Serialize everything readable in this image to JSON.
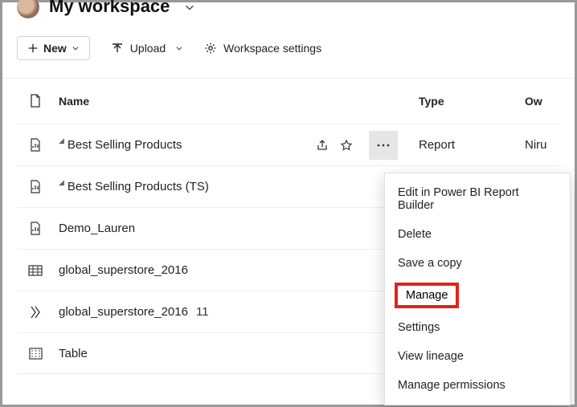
{
  "workspace": {
    "title": "My workspace"
  },
  "toolbar": {
    "new_label": "New",
    "upload_label": "Upload",
    "settings_label": "Workspace settings"
  },
  "columns": {
    "name": "Name",
    "type": "Type",
    "owner": "Owner"
  },
  "rows": [
    {
      "name": "Best Selling Products",
      "type": "Report",
      "owner": "Niru",
      "certified": true
    },
    {
      "name": "Best Selling Products (TS)",
      "certified": true
    },
    {
      "name": "Demo_Lauren"
    },
    {
      "name": "global_superstore_2016"
    },
    {
      "name": "global_superstore_2016",
      "count": "11"
    },
    {
      "name": "Table"
    }
  ],
  "menu": {
    "edit": "Edit in Power BI Report Builder",
    "delete": "Delete",
    "save_copy": "Save a copy",
    "manage": "Manage",
    "settings": "Settings",
    "view_lineage": "View lineage",
    "manage_permissions": "Manage permissions"
  }
}
